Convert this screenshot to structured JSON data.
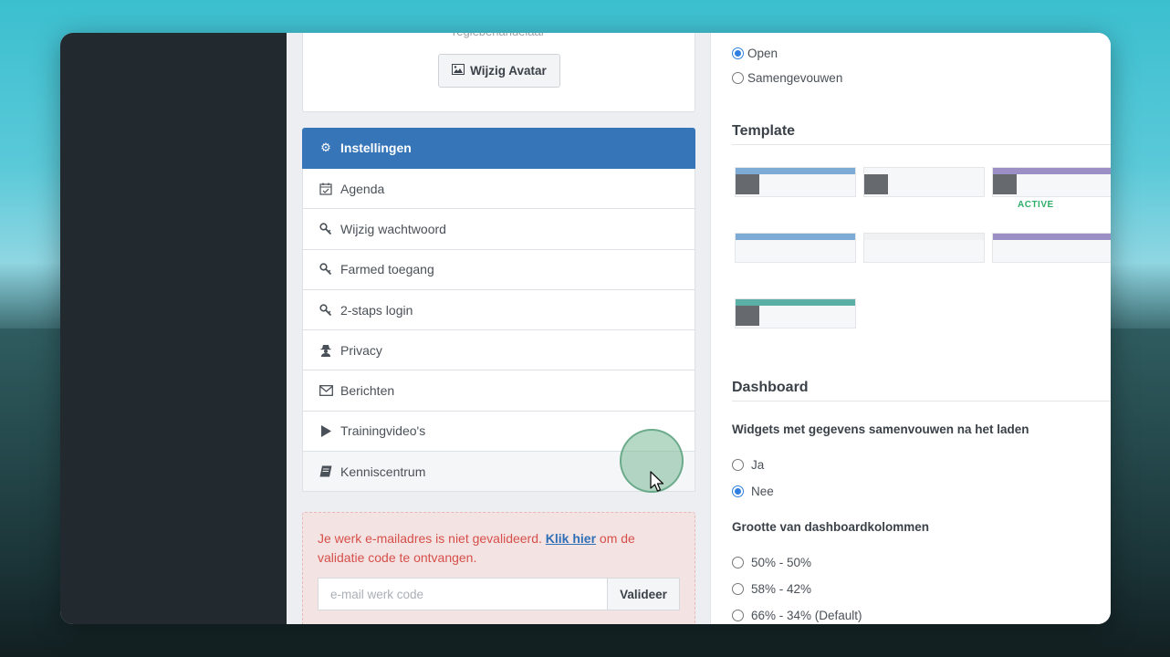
{
  "avatar": {
    "role_text": "regiebehandelaar",
    "change_avatar_label": "Wijzig Avatar"
  },
  "menu": {
    "items": [
      {
        "label": "Instellingen",
        "icon": "gears-icon",
        "glyph": "⚙"
      },
      {
        "label": "Agenda",
        "icon": "calendar-check-icon",
        "glyph": "📅"
      },
      {
        "label": "Wijzig wachtwoord",
        "icon": "key-icon",
        "glyph": "🔑"
      },
      {
        "label": "Farmed toegang",
        "icon": "key-icon",
        "glyph": "🔑"
      },
      {
        "label": "2-staps login",
        "icon": "key-icon",
        "glyph": "🔑"
      },
      {
        "label": "Privacy",
        "icon": "user-secret-icon",
        "glyph": "👤"
      },
      {
        "label": "Berichten",
        "icon": "envelope-icon",
        "glyph": "✉"
      },
      {
        "label": "Trainingvideo's",
        "icon": "play-icon",
        "glyph": "▶"
      },
      {
        "label": "Kenniscentrum",
        "icon": "book-icon",
        "glyph": "📘"
      }
    ],
    "active_index": 0
  },
  "alert": {
    "text_before": "Je werk e-mailadres is niet gevalideerd.",
    "link": "Klik hier",
    "text_after": "om de validatie code te ontvangen.",
    "input_placeholder": "e-mail werk code",
    "button": "Valideer"
  },
  "sidebar_state": {
    "options": [
      "Open",
      "Samengevouwen"
    ],
    "selected": "Open"
  },
  "template": {
    "title": "Template",
    "active_label": "ACTIVE",
    "active_index": 2,
    "swatches": [
      {
        "bar_color": "#7eaad6",
        "has_block": true
      },
      {
        "bar_color": "#f6f7f9",
        "has_block": true
      },
      {
        "bar_color": "#9b8fc6",
        "has_block": true
      },
      {
        "bar_color": "#7eaad6",
        "has_block": false
      },
      {
        "bar_color": "#f0f1f3",
        "has_block": false
      },
      {
        "bar_color": "#9b8fc6",
        "has_block": false
      },
      {
        "bar_color": "#5aafa7",
        "has_block": true
      }
    ]
  },
  "dashboard": {
    "title": "Dashboard",
    "collapse_question": "Widgets met gegevens samenvouwen na het laden",
    "collapse_options": [
      "Ja",
      "Nee"
    ],
    "collapse_selected": "Nee",
    "columns_question": "Grootte van dashboardkolommen",
    "columns_options": [
      "50% - 50%",
      "58% - 42%",
      "66% - 34% (Default)"
    ]
  },
  "colors": {
    "primary": "#3575b8",
    "alert_text": "#d64f4a",
    "active_green": "#2fae6a"
  }
}
